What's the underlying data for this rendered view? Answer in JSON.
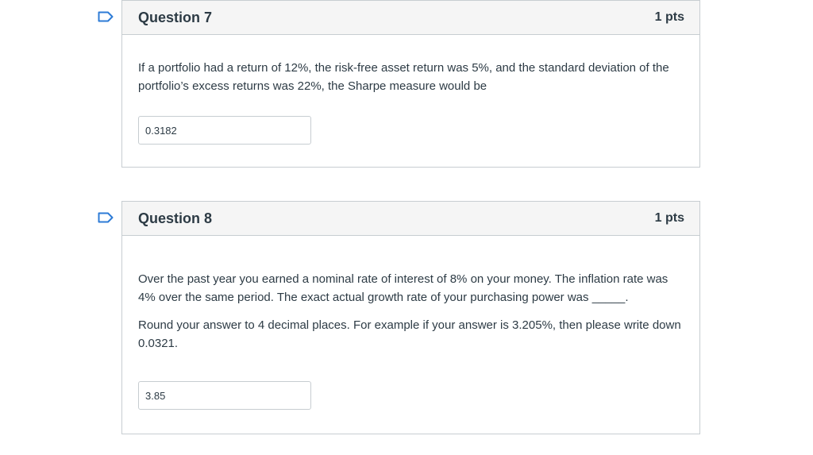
{
  "questions": [
    {
      "title": "Question 7",
      "points": "1 pts",
      "paragraphs": [
        "If a portfolio had a return of 12%, the risk-free asset return was 5%, and the standard deviation of the portfolio’s excess returns was 22%, the Sharpe measure would be"
      ],
      "answer": "0.3182"
    },
    {
      "title": "Question 8",
      "points": "1 pts",
      "paragraphs": [
        "Over the past year you earned a nominal rate of interest of 8% on your money. The inflation rate was 4% over the same period. The exact actual growth rate of your purchasing power was _____.",
        "Round your answer to 4 decimal places. For example if your answer is 3.205%, then please write down 0.0321."
      ],
      "answer": "3.85"
    }
  ],
  "colors": {
    "flag": "#2d7bd6",
    "header_bg": "#f5f5f5",
    "border": "#c7cdd1",
    "text": "#2d3b45"
  },
  "icons": {
    "flag": "bookmark-flag-icon"
  }
}
